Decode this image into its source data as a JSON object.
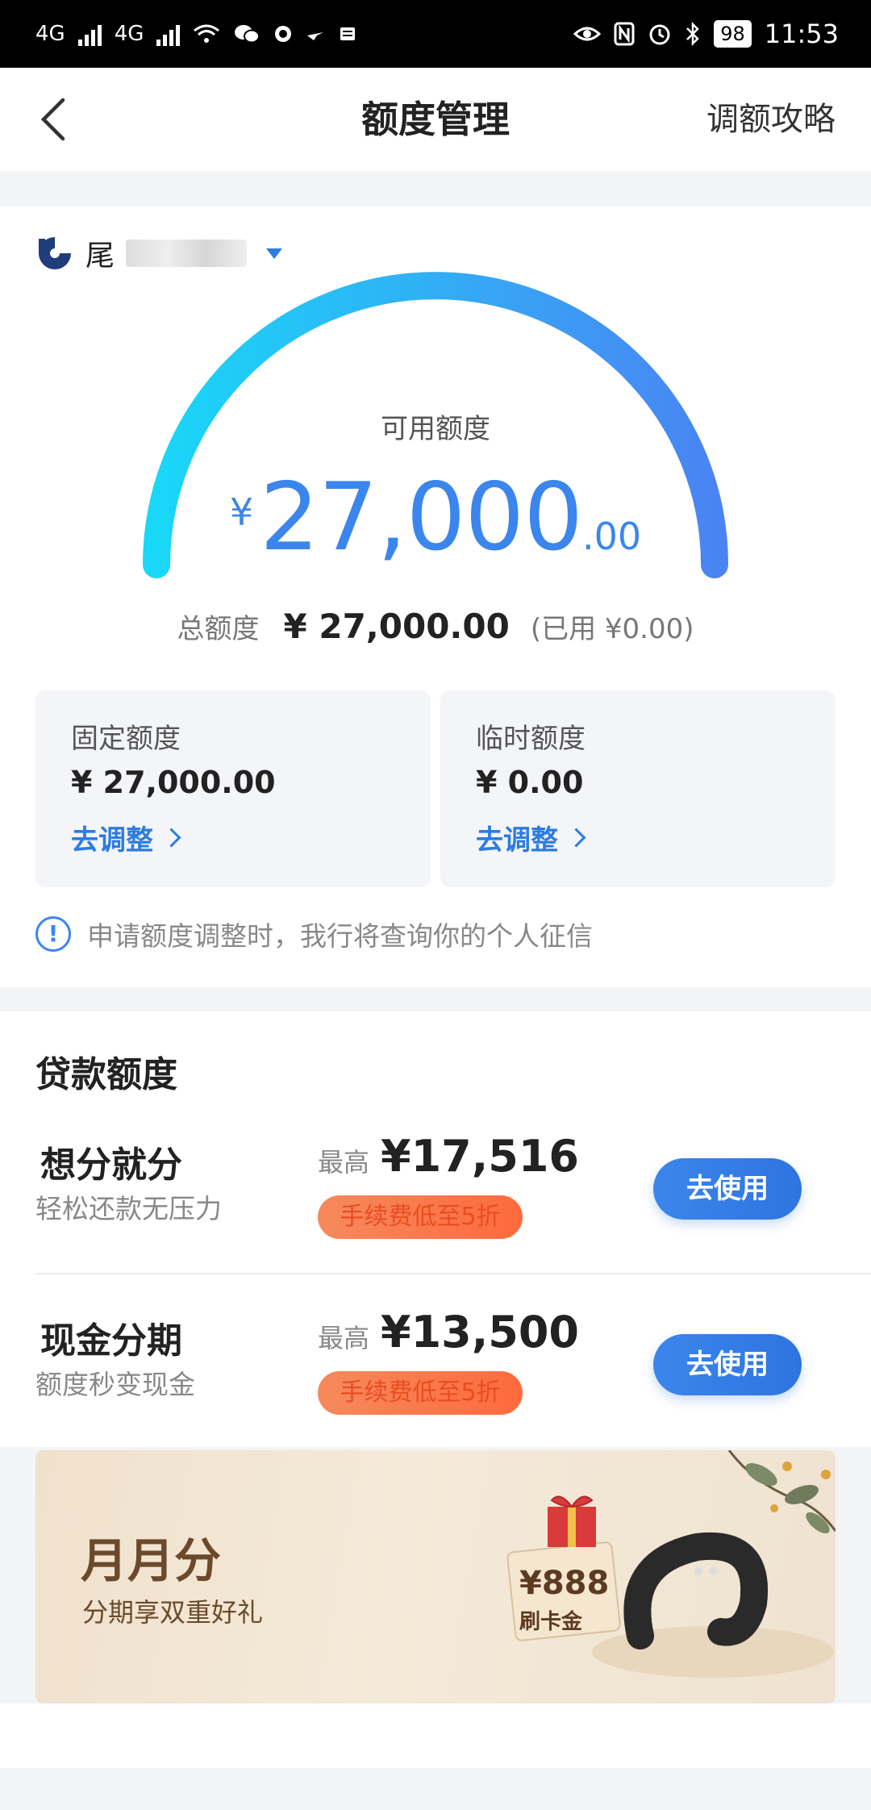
{
  "status_bar": {
    "net1": "4G",
    "net2": "4G",
    "battery": "98",
    "time": "11:53"
  },
  "header": {
    "title": "额度管理",
    "right_link": "调额攻略"
  },
  "account": {
    "bank_name_visible": "尾"
  },
  "quota": {
    "available_label": "可用额度",
    "currency": "¥",
    "available_int": "27,000",
    "available_dec": ".00",
    "total_label": "总额度",
    "total_value": "¥ 27,000.00",
    "used_text": "(已用 ¥0.00)"
  },
  "fixed": {
    "title": "固定额度",
    "value": "¥ 27,000.00",
    "link": "去调整"
  },
  "temp": {
    "title": "临时额度",
    "value": "¥ 0.00",
    "link": "去调整"
  },
  "notice": {
    "icon": "!",
    "text": "申请额度调整时，我行将查询你的个人征信"
  },
  "loan_section": {
    "title": "贷款额度",
    "items": [
      {
        "name": "想分就分",
        "desc": "轻松还款无压力",
        "max_label": "最高",
        "max_value": "¥17,516",
        "fee_tag": "手续费低至5折",
        "button": "去使用"
      },
      {
        "name": "现金分期",
        "desc": "额度秒变现金",
        "max_label": "最高",
        "max_value": "¥13,500",
        "fee_tag": "手续费低至5折",
        "button": "去使用"
      }
    ]
  },
  "banner": {
    "title": "月月分",
    "subtitle": "分期享双重好礼",
    "price": "¥888",
    "card_label": "刷卡金"
  },
  "colors": {
    "accent": "#3b86ec",
    "gauge_start": "#19d7f7",
    "gauge_end": "#4a84f3",
    "fee_tag": "#fe6a3d",
    "banner_text": "#6b4a2c"
  }
}
